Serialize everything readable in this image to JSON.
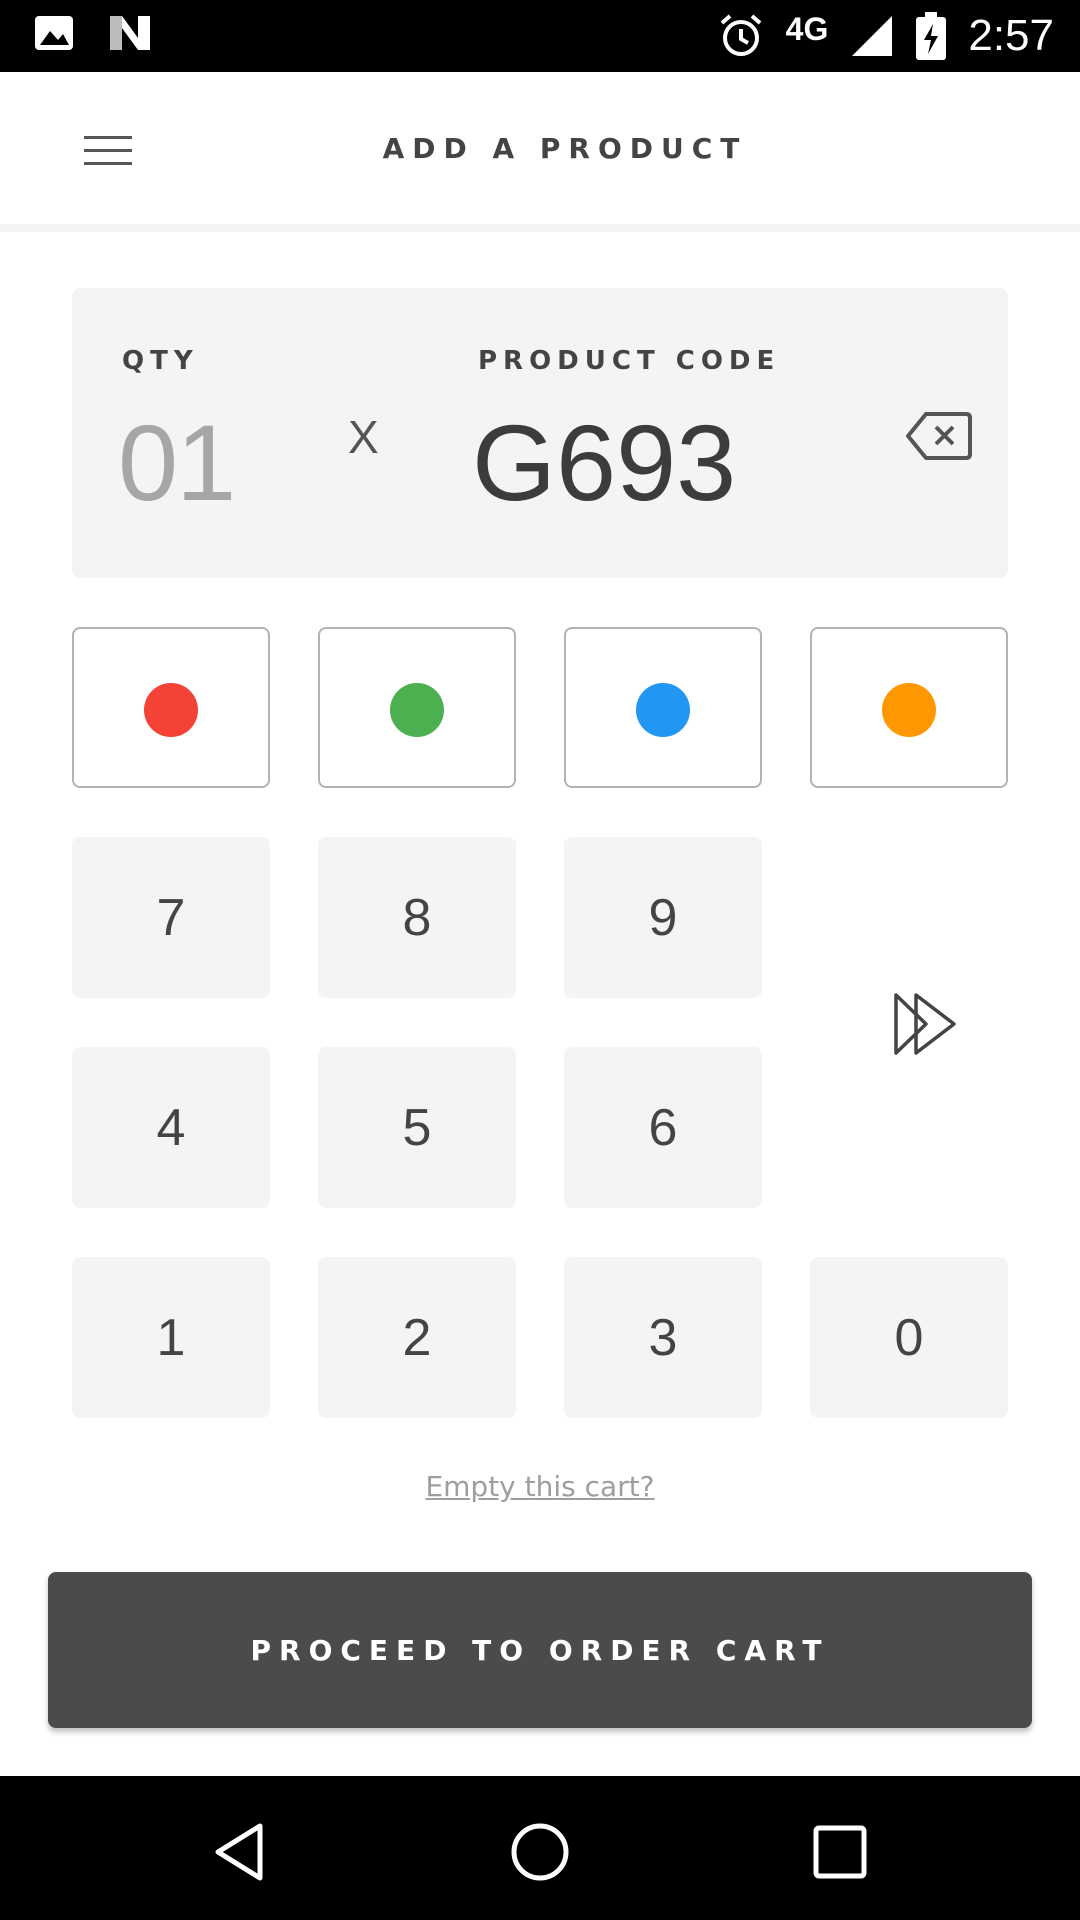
{
  "status_bar": {
    "time": "2:57",
    "network": "4G",
    "icons": [
      "image-icon",
      "n-logo-icon",
      "alarm-icon",
      "signal-icon",
      "battery-charging-icon"
    ]
  },
  "header": {
    "title": "ADD A PRODUCT",
    "menu_icon": "hamburger-menu-icon"
  },
  "display": {
    "qty_label": "QTY",
    "qty_value": "01",
    "times_sign": "X",
    "code_label": "PRODUCT CODE",
    "code_value": "G693",
    "backspace_icon": "backspace-icon"
  },
  "keypad": {
    "colors": [
      {
        "name": "red",
        "hex": "#f44336"
      },
      {
        "name": "green",
        "hex": "#4caf50"
      },
      {
        "name": "blue",
        "hex": "#2196f3"
      },
      {
        "name": "orange",
        "hex": "#ff9800"
      }
    ],
    "keys": {
      "k7": "7",
      "k8": "8",
      "k9": "9",
      "k4": "4",
      "k5": "5",
      "k6": "6",
      "k1": "1",
      "k2": "2",
      "k3": "3",
      "k0": "0"
    },
    "enter_icon": "double-chevron-right-icon"
  },
  "empty_cart_link": "Empty this cart?",
  "proceed_button": "PROCEED TO ORDER CART",
  "nav_bar": {
    "icons": [
      "back-icon",
      "home-icon",
      "recents-icon"
    ]
  },
  "theme": {
    "panel_bg": "#f4f4f4",
    "button_dark": "#4b4b4b",
    "text_primary": "#3c3c3c",
    "text_muted": "#a6a6a6"
  }
}
